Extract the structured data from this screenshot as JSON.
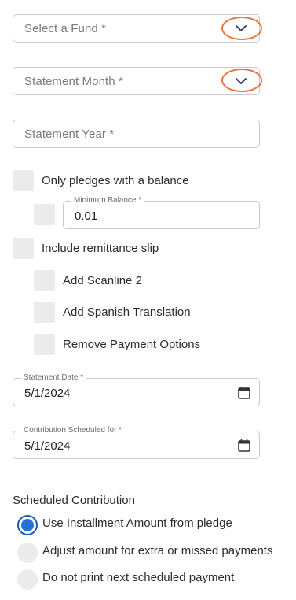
{
  "fund": {
    "placeholder": "Select a Fund *",
    "icon": "chevron-down-icon"
  },
  "month": {
    "placeholder": "Statement Month *",
    "icon": "chevron-down-icon"
  },
  "year": {
    "placeholder": "Statement Year *"
  },
  "pledges_balance": {
    "label": "Only pledges with a balance",
    "checked": false
  },
  "minimum_balance": {
    "label": "Minimum Balance *",
    "value": "0.01"
  },
  "remittance": {
    "label": "Include remittance slip",
    "checked": false
  },
  "scanline": {
    "label": "Add Scanline 2",
    "checked": false
  },
  "spanish": {
    "label": "Add Spanish Translation",
    "checked": false
  },
  "remove_payment": {
    "label": "Remove Payment Options",
    "checked": false
  },
  "statement_date": {
    "label": "Statement Date *",
    "value": "5/1/2024",
    "icon": "calendar-icon"
  },
  "contribution_date": {
    "label": "Contribution Scheduled for *",
    "value": "5/1/2024",
    "icon": "calendar-icon"
  },
  "scheduled": {
    "title": "Scheduled Contribution",
    "options": [
      {
        "label": "Use Installment Amount from pledge",
        "selected": true
      },
      {
        "label": "Adjust amount for extra or missed payments",
        "selected": false
      },
      {
        "label": "Do not print next scheduled payment",
        "selected": false
      }
    ]
  },
  "colors": {
    "highlight_ring": "#e8743b",
    "radio_selected": "#2770d6",
    "checkbox_bg": "#ebebeb"
  }
}
